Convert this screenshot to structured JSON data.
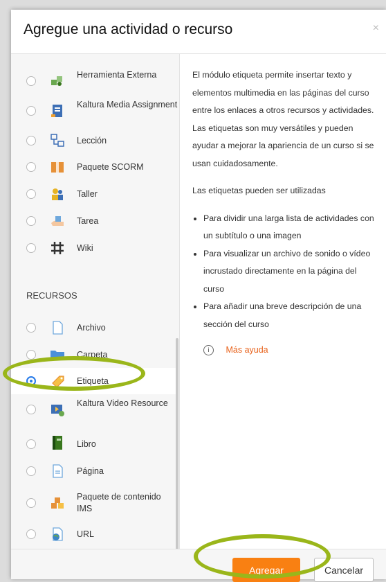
{
  "modal": {
    "title": "Agregue una actividad o recurso",
    "close": "×"
  },
  "options": {
    "activities": [
      {
        "label": "Herramienta Externa",
        "icon": "puzzle-icon"
      },
      {
        "label": "Kaltura Media Assignment",
        "icon": "kaltura-assignment-icon"
      },
      {
        "label": "Lección",
        "icon": "lesson-icon"
      },
      {
        "label": "Paquete SCORM",
        "icon": "scorm-package-icon"
      },
      {
        "label": "Taller",
        "icon": "workshop-icon"
      },
      {
        "label": "Tarea",
        "icon": "assignment-icon"
      },
      {
        "label": "Wiki",
        "icon": "wiki-icon"
      }
    ],
    "resources_heading": "RECURSOS",
    "resources": [
      {
        "label": "Archivo",
        "icon": "file-icon"
      },
      {
        "label": "Carpeta",
        "icon": "folder-icon"
      },
      {
        "label": "Etiqueta",
        "icon": "label-tag-icon",
        "selected": true
      },
      {
        "label": "Kaltura Video Resource",
        "icon": "kaltura-video-icon"
      },
      {
        "label": "Libro",
        "icon": "book-icon"
      },
      {
        "label": "Página",
        "icon": "page-icon"
      },
      {
        "label": "Paquete de contenido IMS",
        "icon": "ims-package-icon"
      },
      {
        "label": "URL",
        "icon": "url-globe-icon"
      }
    ]
  },
  "details": {
    "intro": "El módulo etiqueta permite insertar texto y elementos multimedia en las páginas del curso entre los enlaces a otros recursos y actividades. Las etiquetas son muy versátiles y pueden ayudar a mejorar la apariencia de un curso si se usan cuidadosamente.",
    "uses_heading": "Las etiquetas pueden ser utilizadas",
    "uses": [
      "Para dividir una larga lista de actividades con un subtítulo o una imagen",
      "Para visualizar un archivo de sonido o vídeo incrustado directamente en la página del curso",
      "Para añadir una breve descripción de una sección del curso"
    ],
    "help_link": "Más ayuda"
  },
  "footer": {
    "add_label": "Agregar",
    "cancel_label": "Cancelar"
  },
  "colors": {
    "accent": "#f98012",
    "highlight": "#9ab61a",
    "radio_selected": "#2b7de9"
  }
}
